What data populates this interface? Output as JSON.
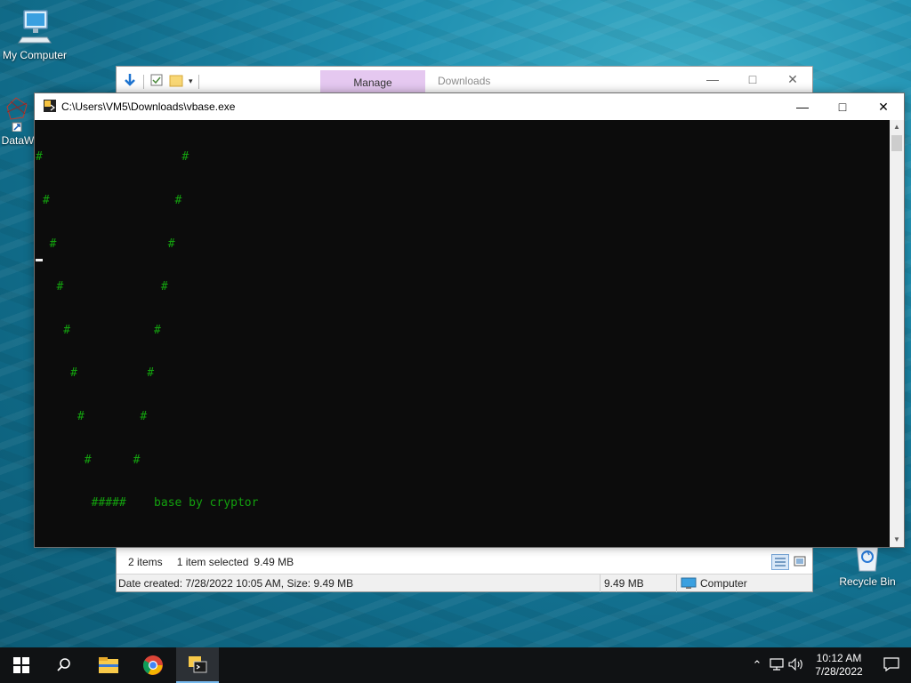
{
  "desktop": {
    "icons": [
      {
        "label": "My Computer",
        "icon": "computer-icon"
      },
      {
        "label": "DataW",
        "icon": "shortcut-icon"
      },
      {
        "label": "Recycle Bin",
        "icon": "recycle-bin-icon"
      }
    ]
  },
  "explorer": {
    "ribbon_tab": "Manage",
    "title": "Downloads",
    "status": {
      "items": "2 items",
      "selected": "1 item selected",
      "size": "9.49 MB"
    },
    "details": {
      "info": "Date created: 7/28/2022 10:05 AM, Size: 9.49 MB",
      "size": "9.49 MB",
      "location": "Computer"
    }
  },
  "console": {
    "title": "C:\\Users\\VM5\\Downloads\\vbase.exe",
    "lines": [
      "#                    #",
      " #                  #",
      "  #                #",
      "   #              #",
      "    #            #",
      "     #          #",
      "      #        #",
      "       #      #",
      "        #####    base by cryptor"
    ],
    "text_color": "#13a10e",
    "background": "#0c0c0c"
  },
  "taskbar": {
    "items": [
      "start-icon",
      "search-icon",
      "file-explorer-icon",
      "chrome-icon",
      "console-app-icon"
    ],
    "clock": {
      "time": "10:12 AM",
      "date": "7/28/2022"
    }
  }
}
